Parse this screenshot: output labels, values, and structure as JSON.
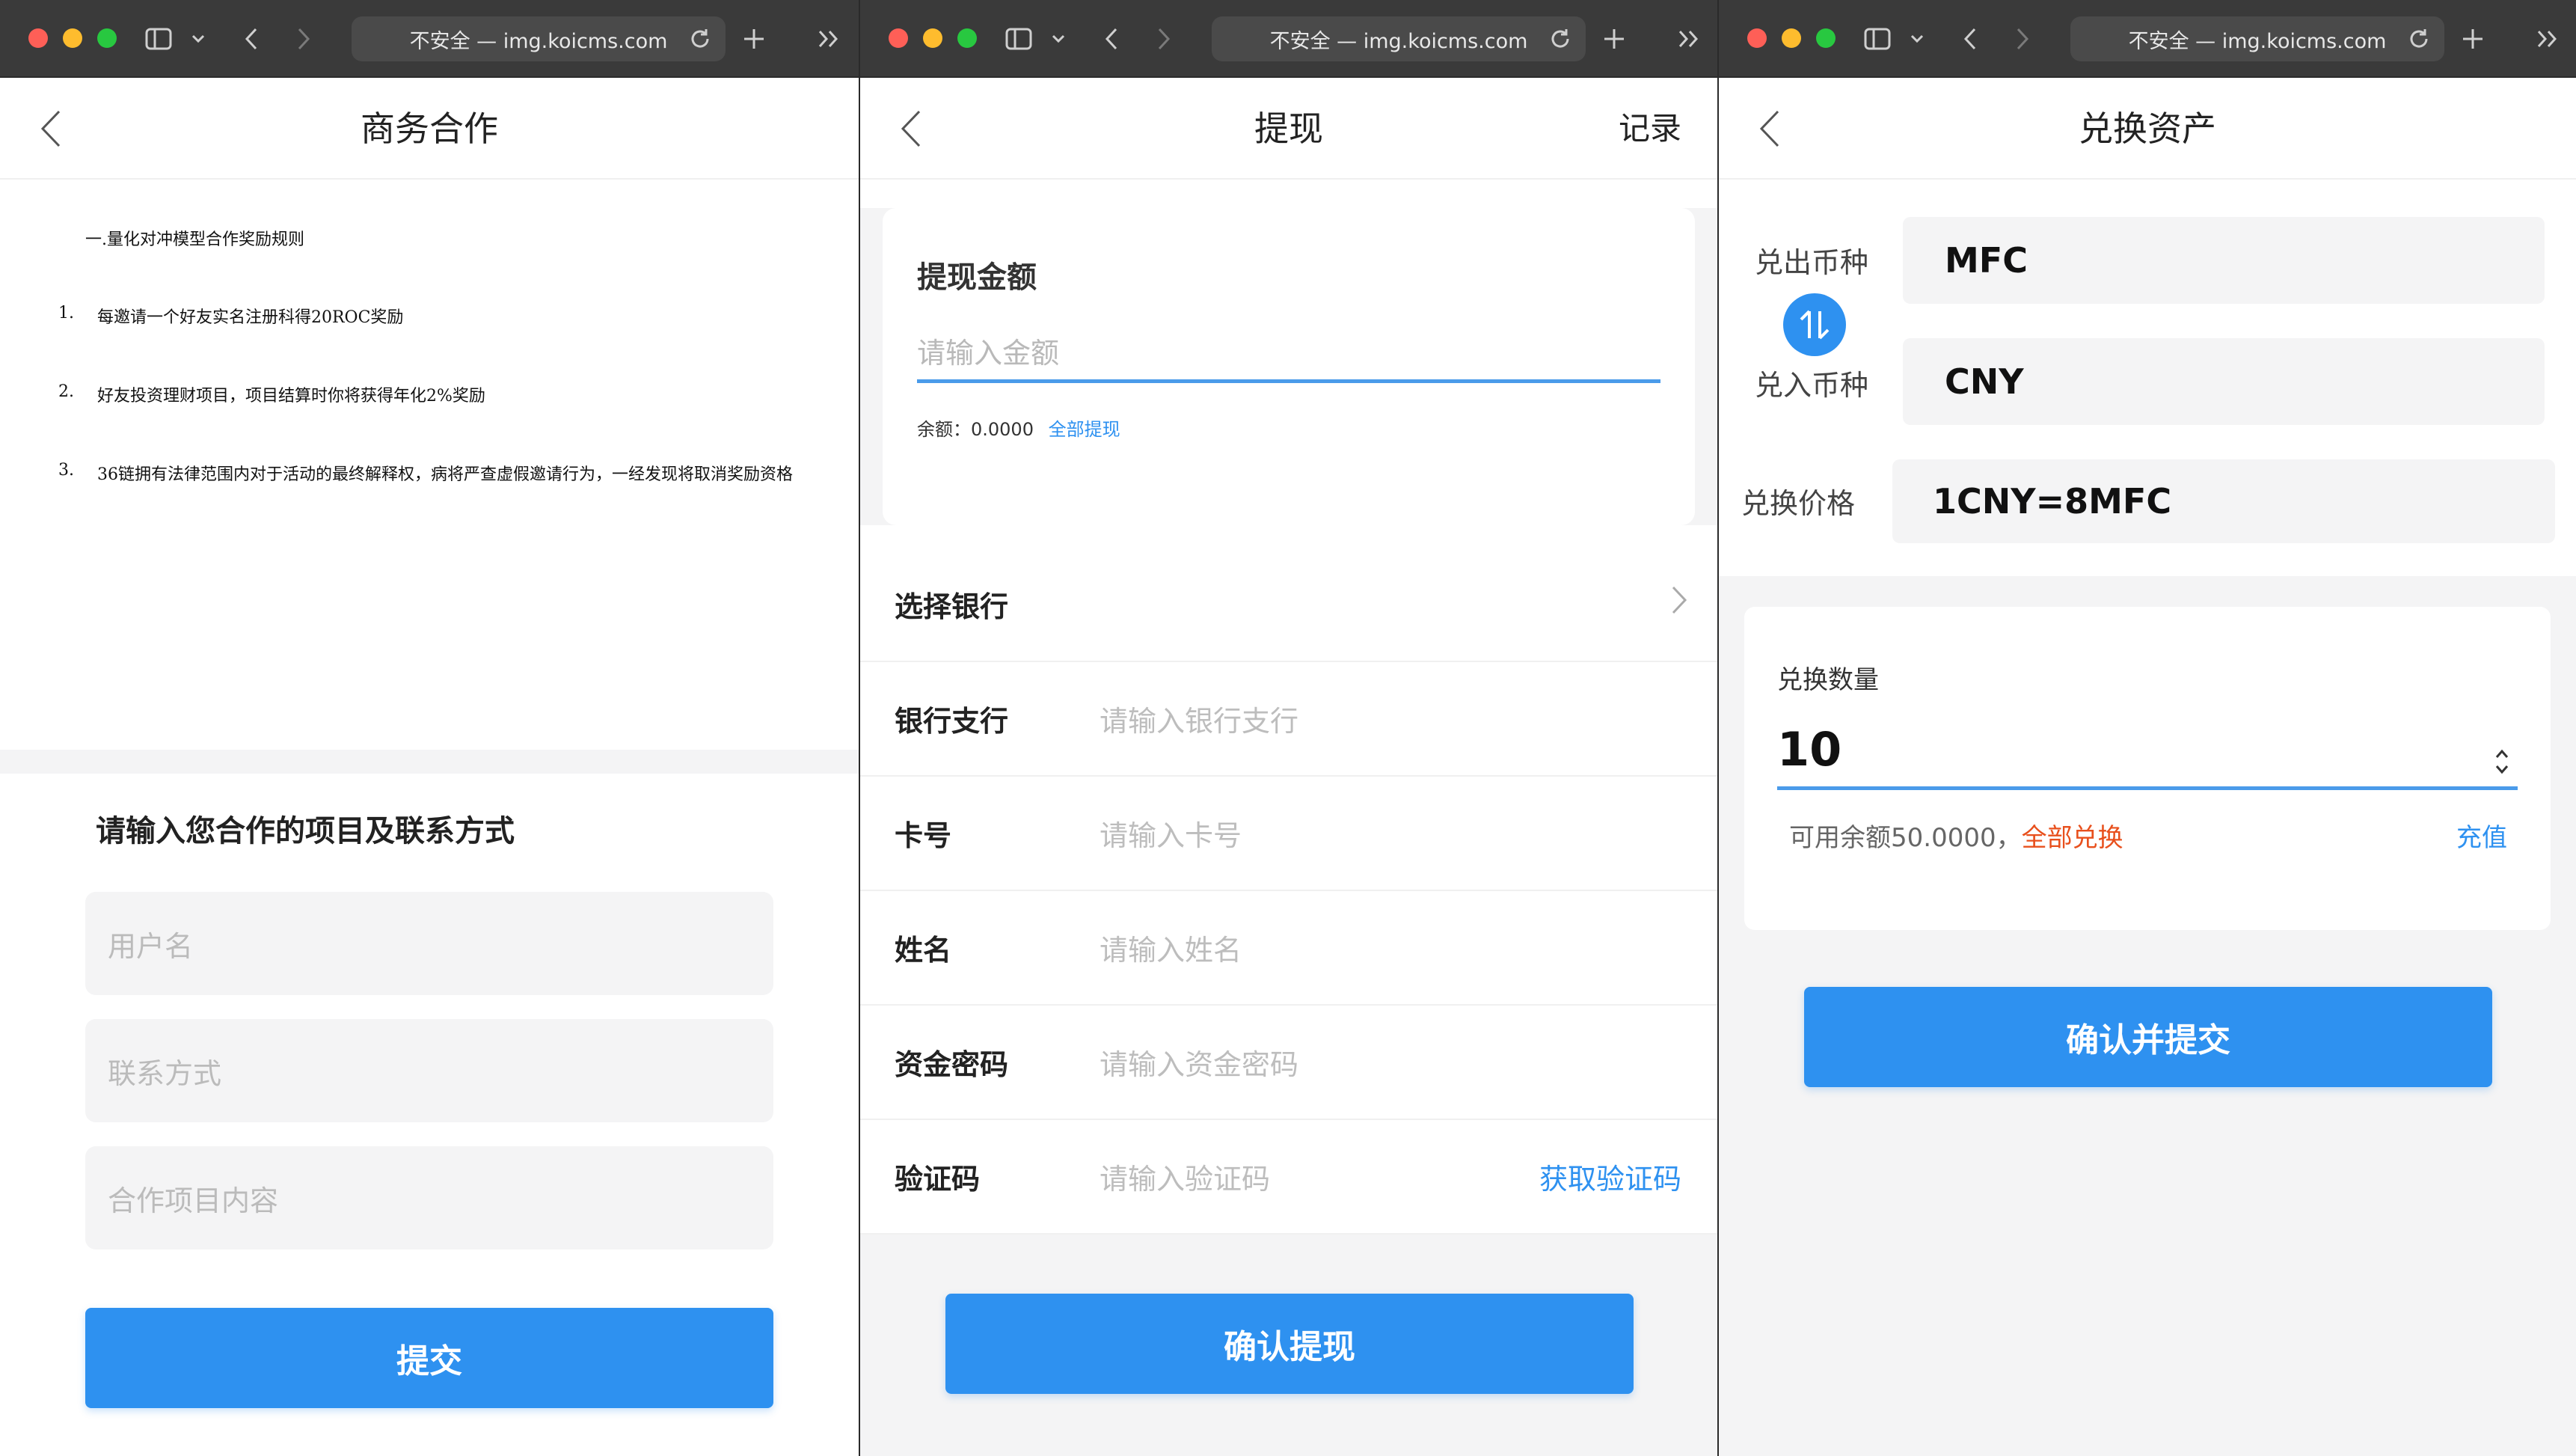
{
  "browser": {
    "url_text": "不安全 — img.koicms.com"
  },
  "screen1": {
    "title": "商务合作",
    "rules_heading": "一.量化对冲模型合作奖励规则",
    "rules": [
      {
        "num": "1.",
        "text": "每邀请一个好友实名注册科得20ROC奖励"
      },
      {
        "num": "2.",
        "text": "好友投资理财项目，项目结算时你将获得年化2%奖励"
      },
      {
        "num": "3.",
        "text": "36链拥有法律范围内对于活动的最终解释权，病将严查虚假邀请行为，一经发现将取消奖励资格"
      }
    ],
    "form_heading": "请输入您合作的项目及联系方式",
    "fields": [
      {
        "placeholder": "用户名"
      },
      {
        "placeholder": "联系方式"
      },
      {
        "placeholder": "合作项目内容"
      }
    ],
    "submit_label": "提交"
  },
  "screen2": {
    "title": "提现",
    "records_label": "记录",
    "amount_label": "提现金额",
    "amount_placeholder": "请输入金额",
    "balance_label": "余额：0.0000",
    "withdraw_all_label": "全部提现",
    "rows": [
      {
        "label": "选择银行",
        "placeholder": ""
      },
      {
        "label": "银行支行",
        "placeholder": "请输入银行支行"
      },
      {
        "label": "卡号",
        "placeholder": "请输入卡号"
      },
      {
        "label": "姓名",
        "placeholder": "请输入姓名"
      },
      {
        "label": "资金密码",
        "placeholder": "请输入资金密码"
      },
      {
        "label": "验证码",
        "placeholder": "请输入验证码"
      }
    ],
    "get_code_label": "获取验证码",
    "confirm_label": "确认提现"
  },
  "screen3": {
    "title": "兑换资产",
    "from_label": "兑出币种",
    "from_value": "MFC",
    "to_label": "兑入币种",
    "to_value": "CNY",
    "price_label": "兑换价格",
    "price_value": "1CNY=8MFC",
    "qty_label": "兑换数量",
    "qty_value": "10",
    "available_label": "可用余额50.0000，",
    "exchange_all_label": "全部兑换",
    "recharge_label": "充值",
    "confirm_label": "确认并提交"
  },
  "colors": {
    "accent": "#2e91f0",
    "warning": "#e8501d",
    "toolbar": "#3a3a3a"
  }
}
